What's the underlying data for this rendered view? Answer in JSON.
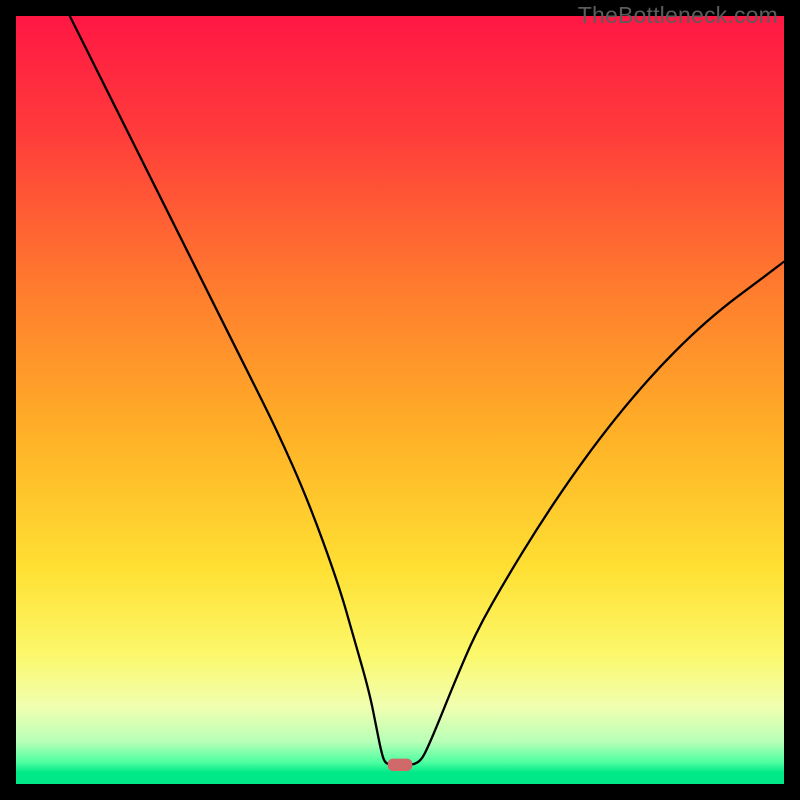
{
  "watermark": "TheBottleneck.com",
  "chart_data": {
    "type": "line",
    "title": "",
    "xlabel": "",
    "ylabel": "",
    "xlim": [
      0,
      100
    ],
    "ylim": [
      0,
      100
    ],
    "grid": false,
    "legend": false,
    "background": {
      "description": "Vertical gradient from red (top) through orange and yellow to bright green (bottom), with a thin bright-green band near the very bottom.",
      "stops": [
        {
          "pos": 0.0,
          "color": "#ff1744"
        },
        {
          "pos": 0.15,
          "color": "#ff3b3b"
        },
        {
          "pos": 0.35,
          "color": "#ff7a2e"
        },
        {
          "pos": 0.55,
          "color": "#ffb227"
        },
        {
          "pos": 0.72,
          "color": "#ffe033"
        },
        {
          "pos": 0.83,
          "color": "#fcf86a"
        },
        {
          "pos": 0.9,
          "color": "#f0ffb0"
        },
        {
          "pos": 0.945,
          "color": "#b7ffb7"
        },
        {
          "pos": 0.972,
          "color": "#4dffa0"
        },
        {
          "pos": 0.985,
          "color": "#00e887"
        },
        {
          "pos": 1.0,
          "color": "#00e887"
        }
      ]
    },
    "series": [
      {
        "name": "bottleneck-curve",
        "color": "#000000",
        "stroke_width": 2.3,
        "x": [
          7,
          10,
          14,
          18,
          22,
          26,
          30,
          34,
          38,
          42,
          44,
          46,
          47,
          47.5,
          48,
          49,
          50,
          51,
          52,
          52.8,
          53.5,
          55,
          57,
          60,
          64,
          68,
          72,
          76,
          80,
          84,
          88,
          92,
          96,
          100
        ],
        "y": [
          100,
          94,
          86,
          78,
          70,
          62,
          54,
          46,
          37,
          26,
          19,
          12,
          7,
          4.5,
          2.7,
          2.5,
          2.5,
          2.5,
          2.6,
          3.2,
          4.5,
          8,
          13,
          20,
          27,
          33.5,
          39.5,
          45,
          50,
          54.5,
          58.5,
          62,
          65,
          68
        ]
      }
    ],
    "marker": {
      "name": "min-marker",
      "shape": "rounded-rect",
      "color": "#d06a6a",
      "cx": 50,
      "cy": 2.5,
      "w": 3.2,
      "h": 1.6
    }
  }
}
